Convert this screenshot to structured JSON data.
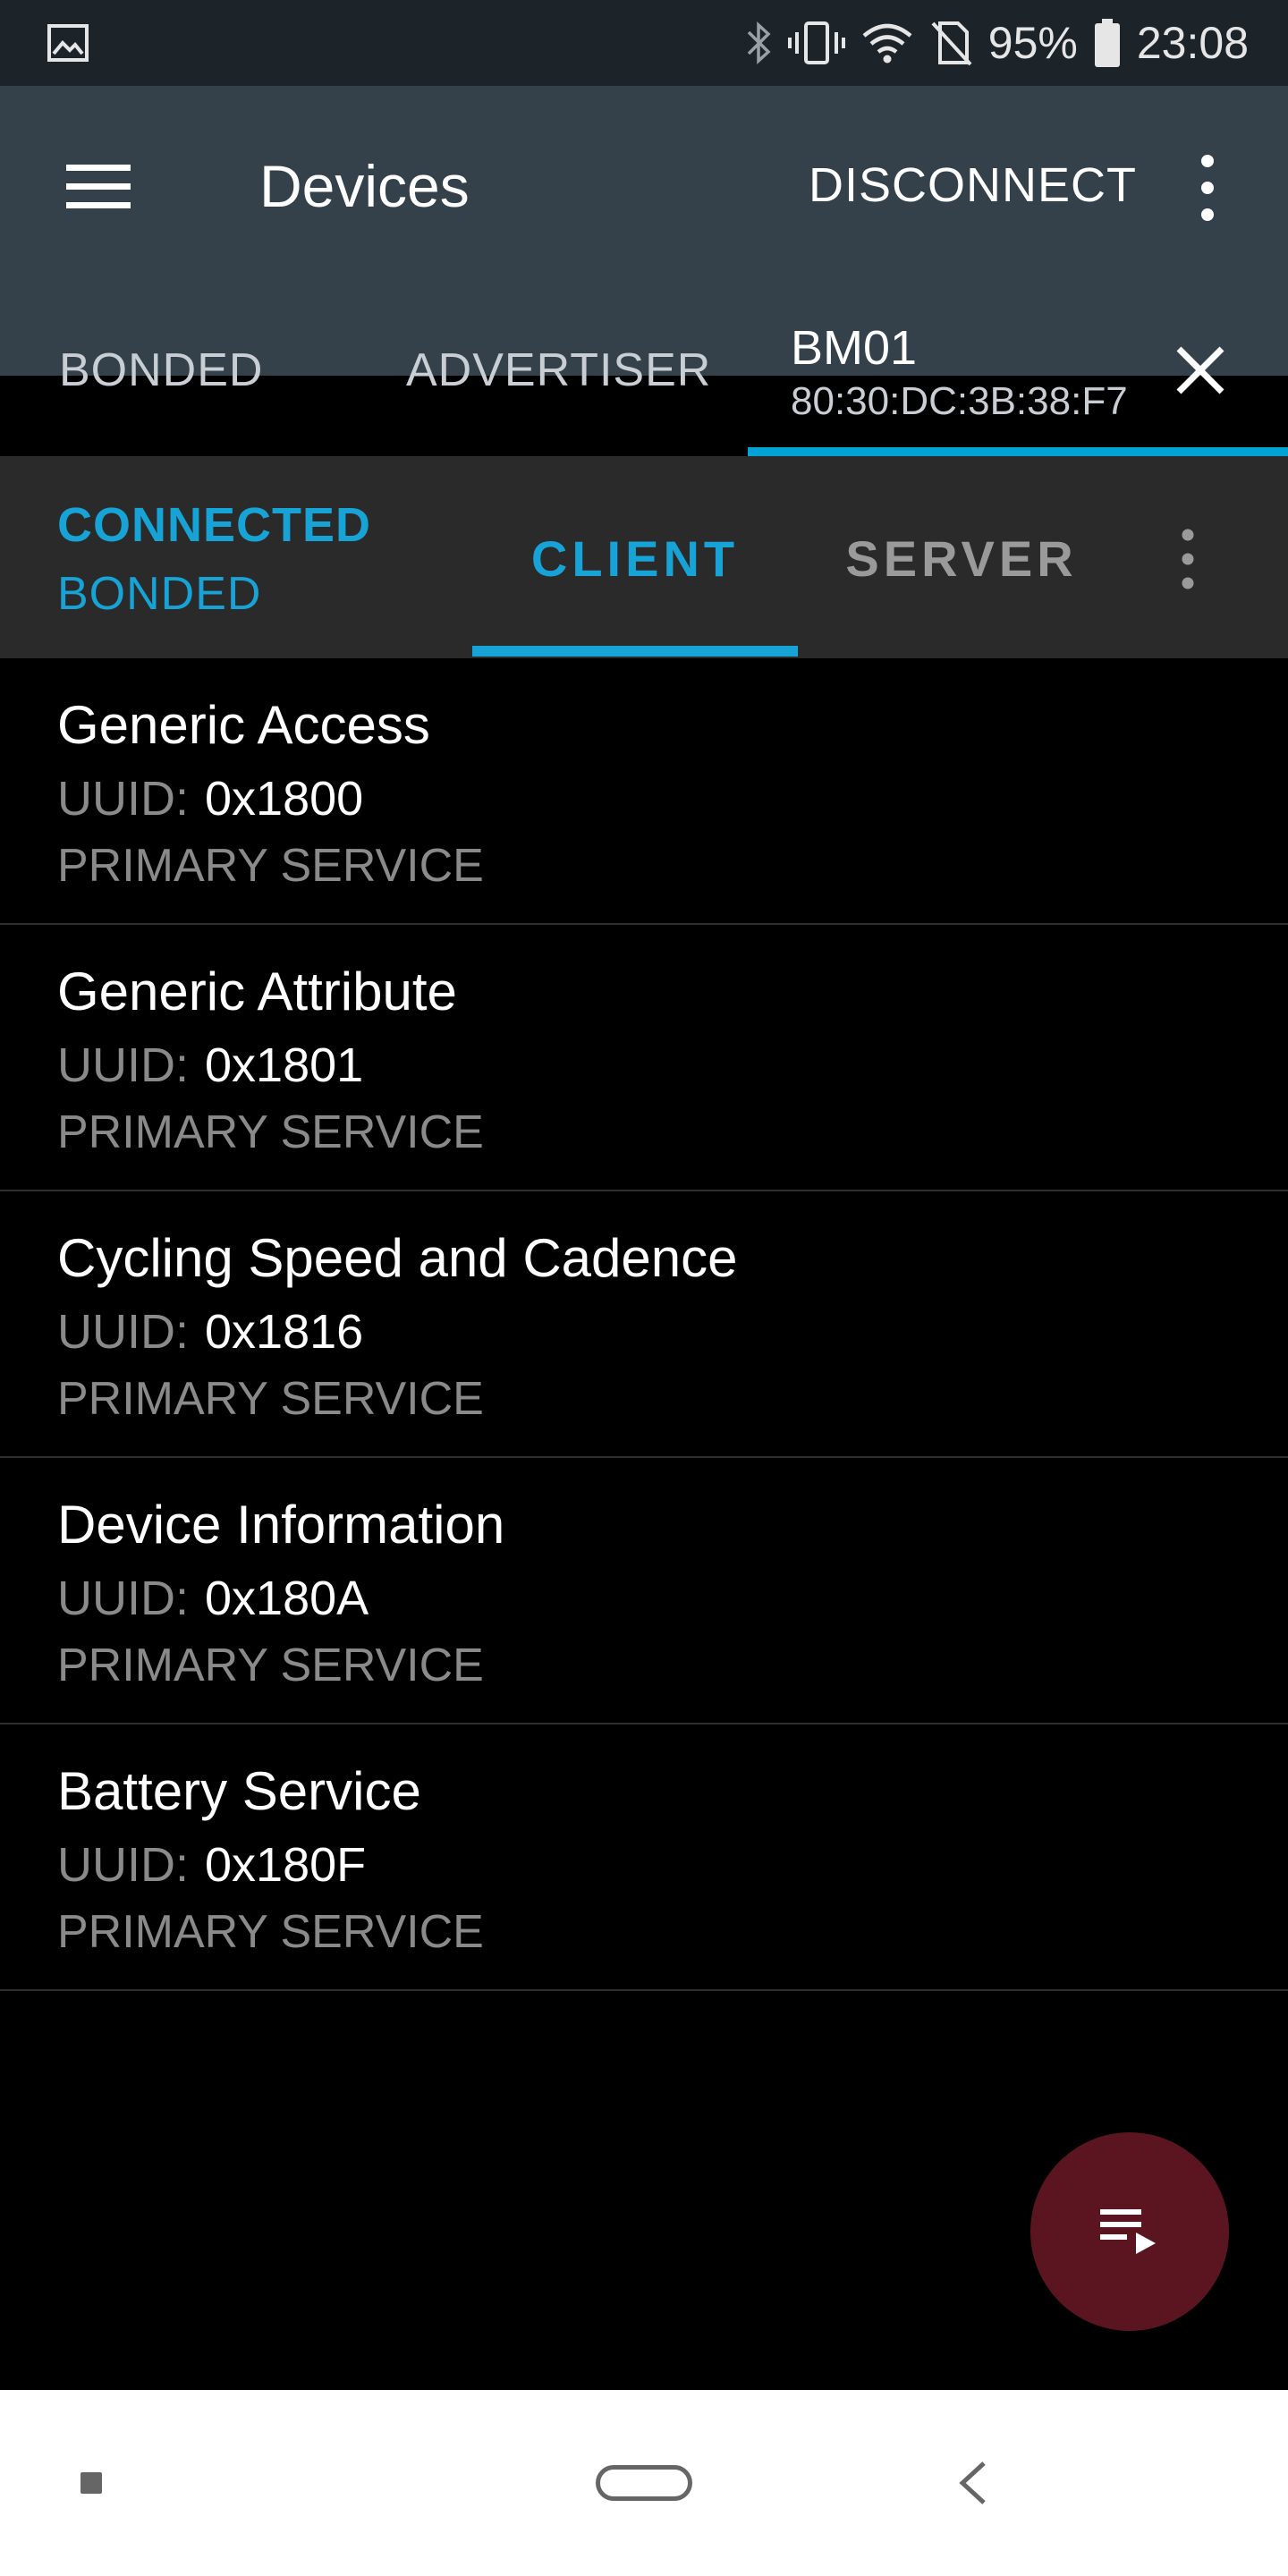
{
  "status_bar": {
    "battery_percent": "95%",
    "time": "23:08",
    "icons": [
      "gallery-icon",
      "bluetooth-icon",
      "vibrate-icon",
      "wifi-icon",
      "no-sim-icon",
      "battery-icon"
    ]
  },
  "app_bar": {
    "title": "Devices",
    "disconnect_label": "DISCONNECT",
    "tabs": [
      {
        "label": "BONDED"
      },
      {
        "label": "ADVERTISER"
      }
    ],
    "device_tab": {
      "name": "BM01",
      "address": "80:30:DC:3B:38:F7"
    }
  },
  "connection": {
    "state": "CONNECTED",
    "bond_state": "BONDED"
  },
  "sub_tabs": [
    {
      "label": "CLIENT",
      "selected": true
    },
    {
      "label": "SERVER",
      "selected": false
    }
  ],
  "services": [
    {
      "name": "Generic Access",
      "uuid_label": "UUID:",
      "uuid": "0x1800",
      "type": "PRIMARY SERVICE"
    },
    {
      "name": "Generic Attribute",
      "uuid_label": "UUID:",
      "uuid": "0x1801",
      "type": "PRIMARY SERVICE"
    },
    {
      "name": "Cycling Speed and Cadence",
      "uuid_label": "UUID:",
      "uuid": "0x1816",
      "type": "PRIMARY SERVICE"
    },
    {
      "name": "Device Information",
      "uuid_label": "UUID:",
      "uuid": "0x180A",
      "type": "PRIMARY SERVICE"
    },
    {
      "name": "Battery Service",
      "uuid_label": "UUID:",
      "uuid": "0x180F",
      "type": "PRIMARY SERVICE"
    }
  ],
  "fab": {
    "icon": "playlist-play-icon"
  },
  "colors": {
    "accent": "#17a3d6",
    "app_bar": "#34404a",
    "sub_bar": "#2a2a2a",
    "fab": "#5a1520"
  }
}
